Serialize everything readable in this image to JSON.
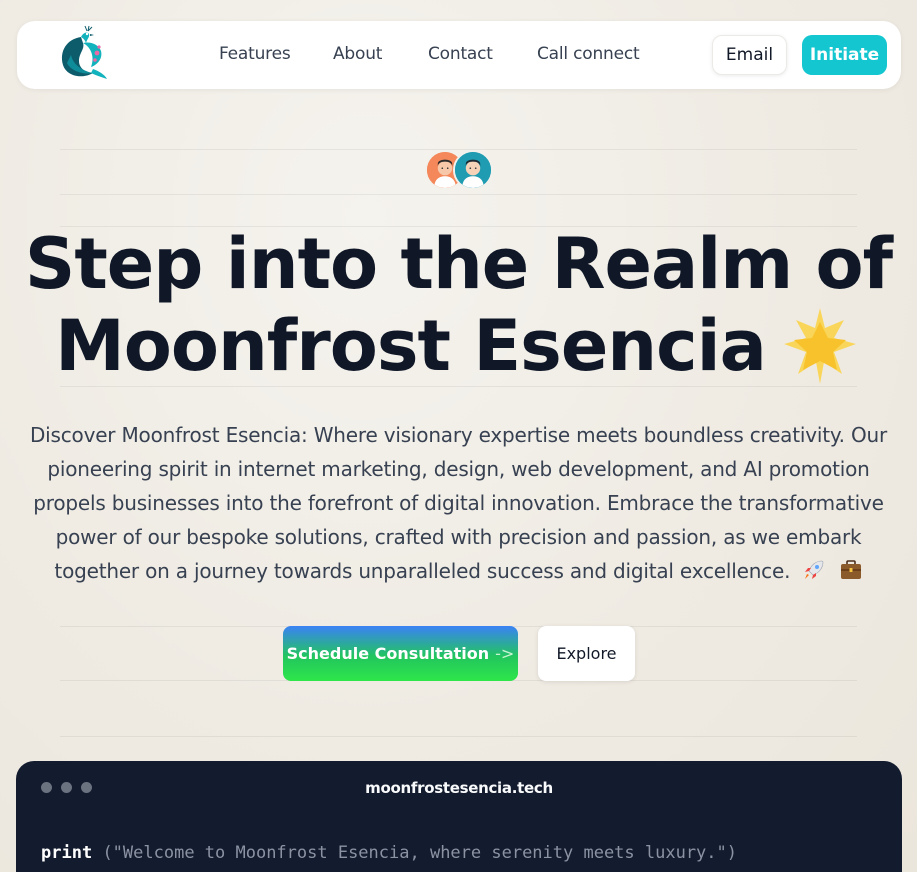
{
  "brand": {
    "logo_icon": "peacock-logo-icon"
  },
  "nav": {
    "links": [
      "Features",
      "About",
      "Contact",
      "Call connect"
    ],
    "email_label": "Email",
    "initiate_label": "Initiate"
  },
  "hero": {
    "avatars": [
      "man-avatar-orange",
      "man-avatar-teal"
    ],
    "title_line1": "Step into the Realm of",
    "title_line2": "Moonfrost Esencia",
    "title_icon": "glowing-star-icon",
    "description": "Discover Moonfrost Esencia: Where visionary expertise meets boundless creativity. Our pioneering spirit in internet marketing, design, web development, and AI promotion propels businesses into the forefront of digital innovation. Embrace the transformative power of our bespoke solutions, crafted with precision and passion, as we embark together on a journey towards unparalleled success and digital excellence.",
    "description_icons": [
      "rocket-icon",
      "briefcase-icon"
    ],
    "cta_primary": "Schedule Consultation",
    "cta_primary_arrow": "->",
    "cta_secondary": "Explore"
  },
  "terminal": {
    "title": "moonfrostesencia.tech",
    "keyword": "print",
    "code_arg": "(\"Welcome to Moonfrost Esencia, where serenity meets luxury.\")"
  },
  "colors": {
    "accent": "#13c6cf",
    "heading": "#101828",
    "terminal_bg": "#131b2e",
    "cta_gradient_top": "#3b82f6",
    "cta_gradient_bottom": "#2ee64a"
  }
}
